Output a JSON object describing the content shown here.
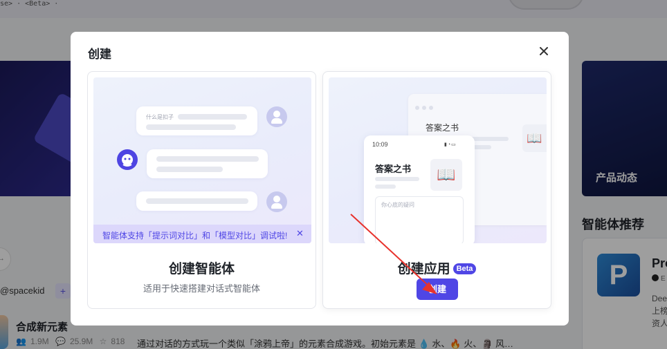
{
  "background": {
    "breadcrumb": "se> · <Beta> ·",
    "banner_label": "产品动态",
    "section_title": "智能体推荐",
    "card": {
      "icon_letter": "P",
      "title": "Pro",
      "author": "E",
      "desc": "Dee 上榜 资人"
    },
    "pill_text": "→",
    "handle": "@spacekid",
    "handle_btn": "+",
    "item": {
      "title": "合成新元素",
      "stats": [
        "1.9M",
        "25.9M",
        "818"
      ],
      "desc": "通过对话的方式玩一个类似「涂鸦上帝」的元素合成游戏。初始元素是 💧 水、🔥 火、🗿 风…"
    }
  },
  "modal": {
    "title": "创建",
    "agent": {
      "title": "创建智能体",
      "subtitle": "适用于快速搭建对话式智能体",
      "preview_hint": "什么是扣子",
      "tip": "智能体支持「提示词对比」和「模型对比」调试啦!",
      "tip_close": "✕"
    },
    "app": {
      "title": "创建应用",
      "badge": "Beta",
      "button": "创建",
      "preview_window_title": "答案之书",
      "preview_phone_time": "10:09",
      "preview_phone_title": "答案之书",
      "preview_input_placeholder": "你心底的疑问"
    }
  },
  "colors": {
    "accent": "#4f46e5",
    "arrow": "#e8322c"
  }
}
